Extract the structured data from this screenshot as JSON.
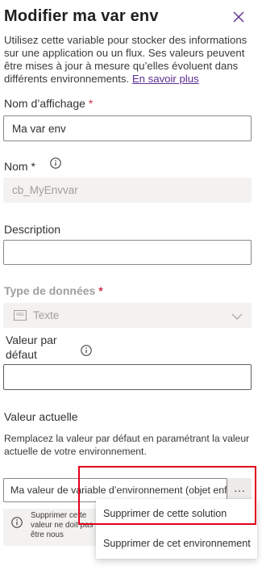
{
  "panel": {
    "title": "Modifier ma var env",
    "description": "Utilisez cette variable pour stocker des informations sur une application ou un flux. Ses valeurs peuvent être mises à jour à mesure qu’elles évoluent dans différents environnements.",
    "learn_more": "En savoir plus"
  },
  "fields": {
    "display_name": {
      "label": "Nom d’affichage",
      "required_mark": "*",
      "value": "Ma var env"
    },
    "name": {
      "label": "Nom",
      "required_mark": "*",
      "value": "cb_MyEnvvar"
    },
    "description": {
      "label": "Description",
      "value": ""
    },
    "data_type": {
      "label": "Type de données",
      "required_mark": "*",
      "value": "Texte"
    },
    "default_value": {
      "label_line1": "Valeur par",
      "label_line2": "défaut",
      "value": ""
    },
    "current_value": {
      "heading": "Valeur actuelle",
      "help": "Remplacez la valeur par défaut en paramétrant la valeur actuelle de votre environnement.",
      "value": "Ma valeur de variable d’environnement (objet enf...",
      "more_button": "···"
    }
  },
  "notice": {
    "text": "Supprimer cette valeur ne doit pas être nous"
  },
  "context_menu": {
    "items": [
      "Supprimer de cette solution",
      "Supprimer de cet environnement"
    ]
  },
  "colors": {
    "link": "#5c2d91",
    "required": "#c4314b",
    "highlight": "#e3001b"
  },
  "icons": [
    "close-icon",
    "info-icon",
    "chevron-down-icon",
    "text-type-icon",
    "more-icon"
  ]
}
